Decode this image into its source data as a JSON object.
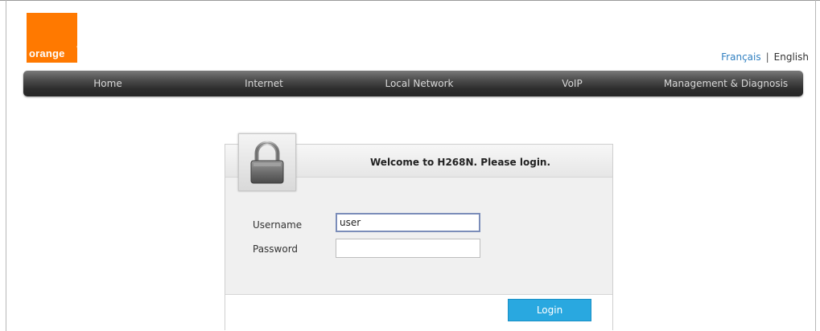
{
  "brand": {
    "logo_text": "orange",
    "tm": "™",
    "color": "#ff7900"
  },
  "language": {
    "french": "Français",
    "separator": "|",
    "english": "English"
  },
  "nav": {
    "items": [
      "Home",
      "Internet",
      "Local Network",
      "VoIP",
      "Management & Diagnosis"
    ]
  },
  "login": {
    "title": "Welcome to H268N. Please login.",
    "username_label": "Username",
    "username_value": "user",
    "password_label": "Password",
    "password_value": "",
    "button_label": "Login",
    "button_color": "#29a8e0"
  }
}
